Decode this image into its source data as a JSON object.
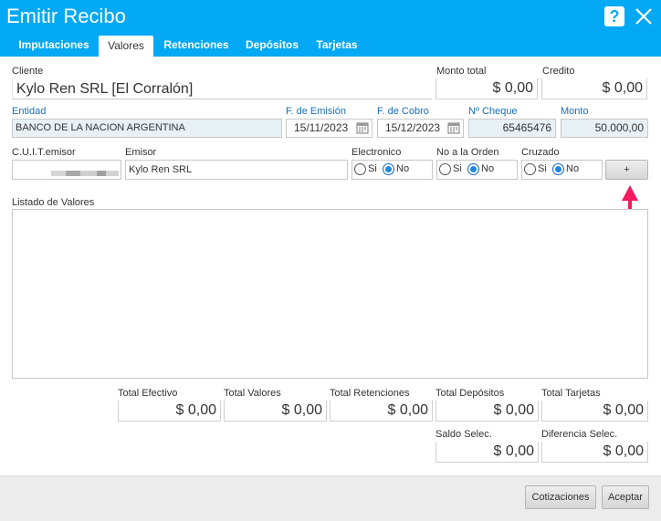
{
  "window": {
    "title": "Emitir Recibo",
    "help_icon": "?"
  },
  "tabs": [
    {
      "label": "Imputaciones"
    },
    {
      "label": "Valores"
    },
    {
      "label": "Retenciones"
    },
    {
      "label": "Depósitos"
    },
    {
      "label": "Tarjetas"
    }
  ],
  "cliente": {
    "label": "Cliente",
    "value": "Kylo Ren SRL [El Corralón]"
  },
  "monto_total": {
    "label": "Monto total",
    "value": "$ 0,00"
  },
  "credito": {
    "label": "Credito",
    "value": "$ 0,00"
  },
  "entidad": {
    "label": "Entidad",
    "value": "BANCO DE LA NACION ARGENTINA"
  },
  "fecha_emision": {
    "label": "F. de Emisión",
    "value": "15/11/2023"
  },
  "fecha_cobro": {
    "label": "F. de Cobro",
    "value": "15/12/2023"
  },
  "nro_cheque": {
    "label": "Nº Cheque",
    "value": "65465476"
  },
  "monto": {
    "label": "Monto",
    "value": "50.000,00"
  },
  "cuit_emisor": {
    "label": "C.U.I.T.emisor"
  },
  "emisor": {
    "label": "Emisor",
    "value": "Kylo Ren SRL"
  },
  "electronico": {
    "label": "Electronico",
    "options": [
      "Si",
      "No"
    ],
    "selected": "No"
  },
  "no_a_la_orden": {
    "label": "No a la Orden",
    "options": [
      "Si",
      "No"
    ],
    "selected": "No"
  },
  "cruzado": {
    "label": "Cruzado",
    "options": [
      "Si",
      "No"
    ],
    "selected": "No"
  },
  "add_button": {
    "label": "+"
  },
  "listado": {
    "label": "Listado de Valores"
  },
  "totales": {
    "efectivo": {
      "label": "Total Efectivo",
      "value": "$ 0,00"
    },
    "valores": {
      "label": "Total Valores",
      "value": "$ 0,00"
    },
    "retenciones": {
      "label": "Total Retenciones",
      "value": "$ 0,00"
    },
    "depositos": {
      "label": "Total Depósitos",
      "value": "$ 0,00"
    },
    "tarjetas": {
      "label": "Total Tarjetas",
      "value": "$ 0,00"
    },
    "saldo_selec": {
      "label": "Saldo Selec.",
      "value": "$ 0,00"
    },
    "diferencia_selec": {
      "label": "Diferencia Selec.",
      "value": "$ 0,00"
    }
  },
  "footer": {
    "cotizaciones_label": "Cotizaciones",
    "aceptar_label": "Aceptar"
  },
  "colors": {
    "accent": "#03a9f4",
    "arrow": "#f5195f",
    "field_label_blue": "#1a6eb4",
    "readonly_bg": "#e8f1f6"
  },
  "icons": [
    "help-icon",
    "close-icon",
    "calendar-icon",
    "annotation-arrow"
  ]
}
